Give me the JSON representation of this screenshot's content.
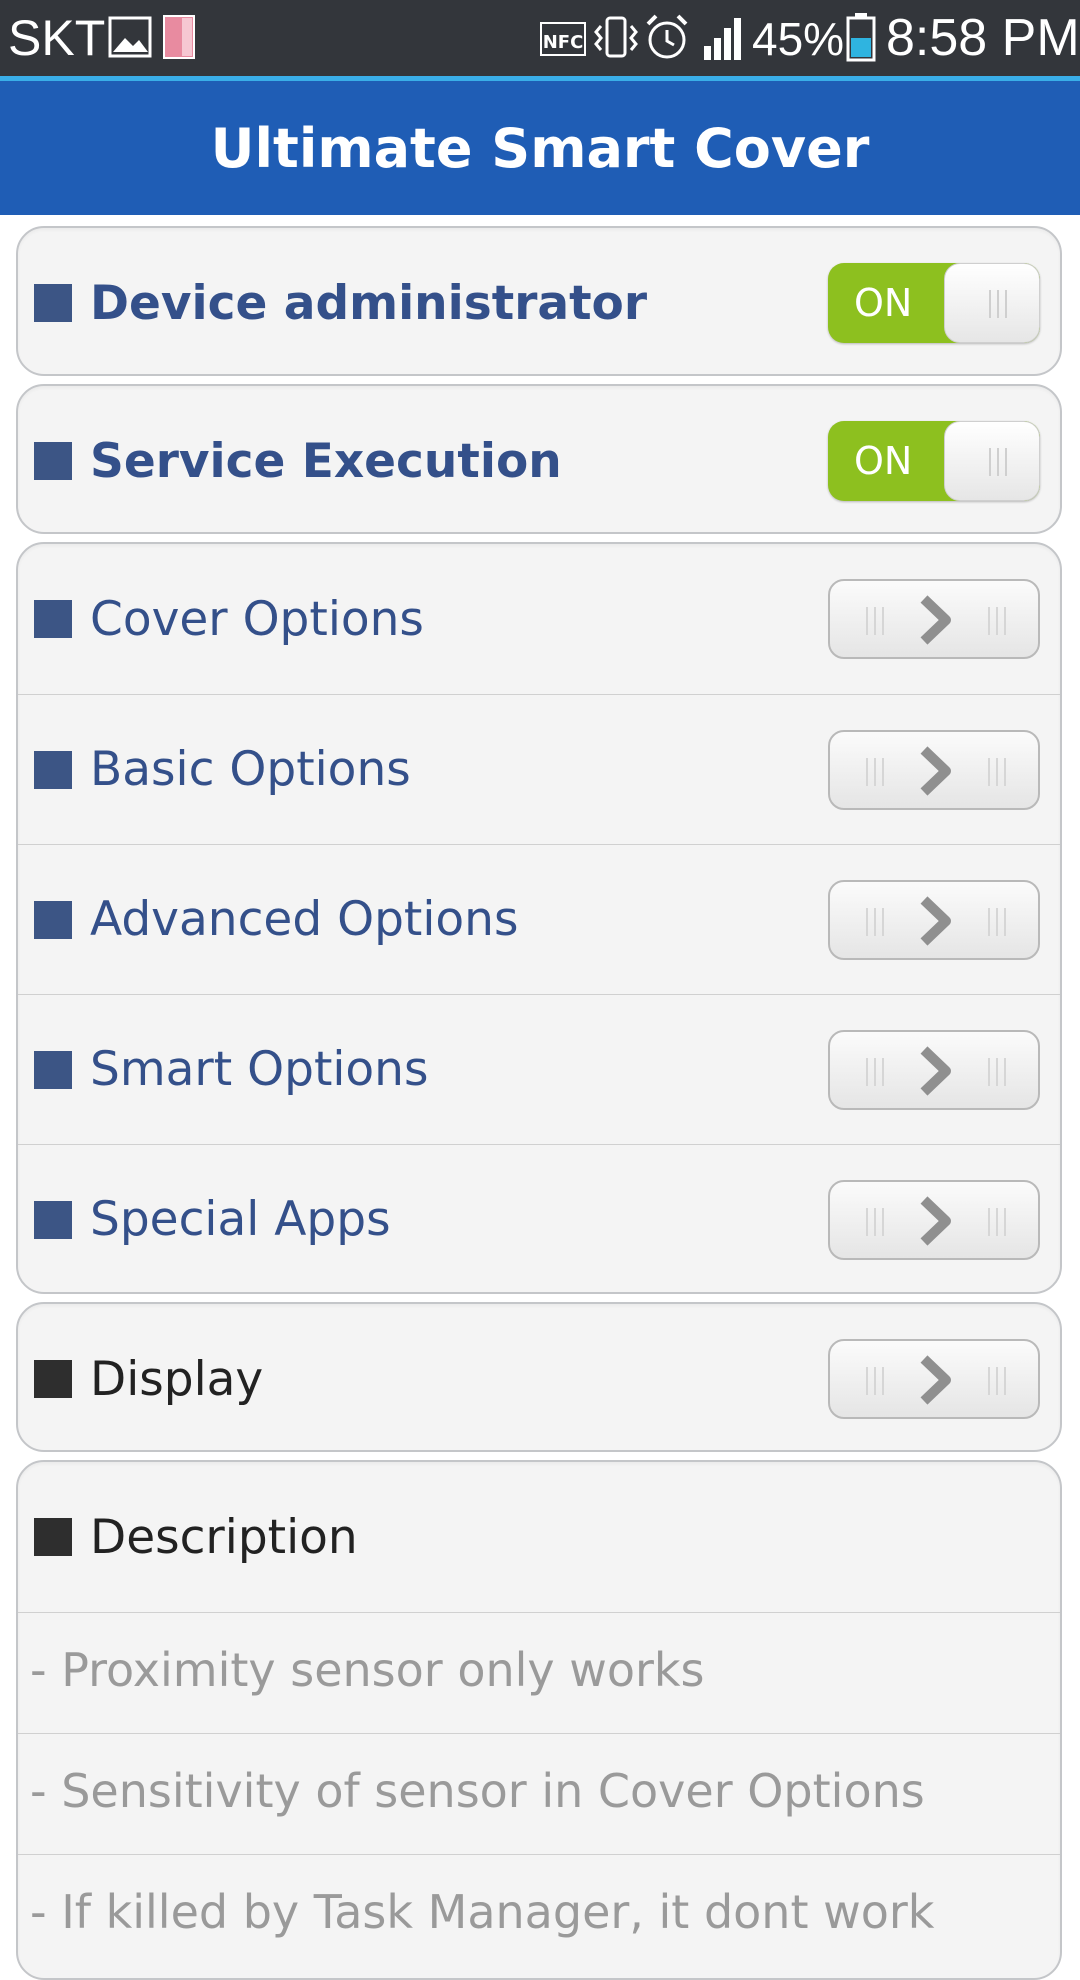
{
  "status_bar": {
    "carrier": "SKT",
    "battery_percent": "45%",
    "clock": "8:58 PM",
    "icons": [
      "image-icon",
      "sim-card-icon",
      "nfc-icon",
      "vibrate-icon",
      "alarm-icon",
      "signal-icon",
      "battery-icon"
    ]
  },
  "header": {
    "title": "Ultimate Smart Cover",
    "color": "#1f5db5"
  },
  "toggles": [
    {
      "label": "Device administrator",
      "state": "ON"
    },
    {
      "label": "Service Execution",
      "state": "ON"
    }
  ],
  "options": [
    {
      "label": "Cover Options"
    },
    {
      "label": "Basic Options"
    },
    {
      "label": "Advanced Options"
    },
    {
      "label": "Smart Options"
    },
    {
      "label": "Special Apps"
    }
  ],
  "display": {
    "label": "Display"
  },
  "description": {
    "heading": "Description",
    "lines": [
      "- Proximity sensor only works",
      "- Sensitivity of sensor in Cover Options",
      "- If killed by Task Manager, it dont work"
    ]
  },
  "colors": {
    "toggle_on": "#8dc01f",
    "label_blue": "#34508a",
    "bullet_blue": "#3c5585"
  }
}
